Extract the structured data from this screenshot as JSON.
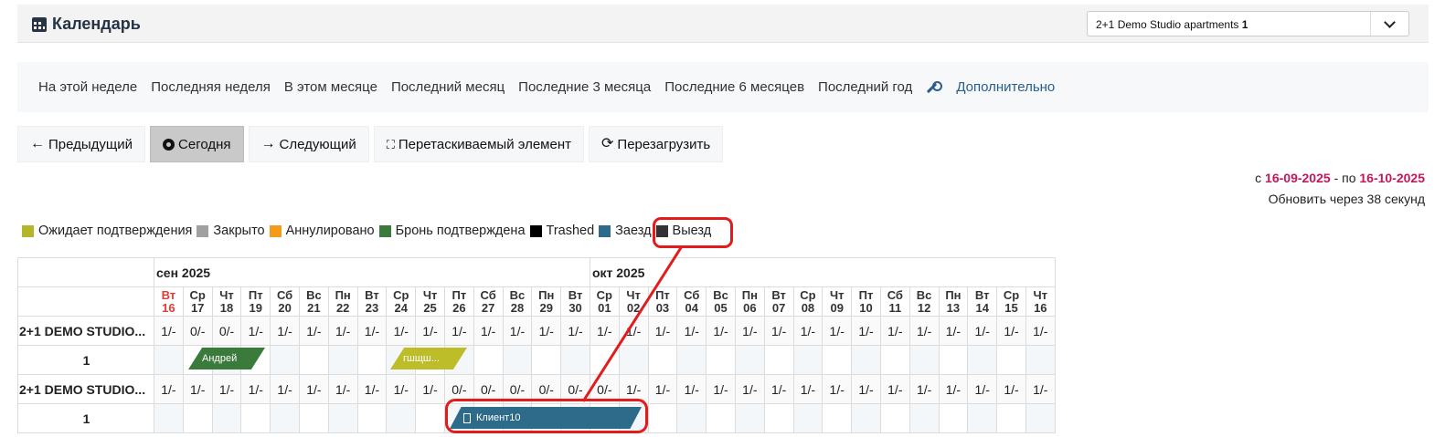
{
  "header": {
    "title": "Календарь",
    "property_select": {
      "name": "2+1 Demo Studio apartments",
      "number": "1"
    }
  },
  "ranges": [
    "На этой неделе",
    "Последняя неделя",
    "В этом месяце",
    "Последний месяц",
    "Последние 3 месяца",
    "Последние 6 месяцев",
    "Последний год"
  ],
  "ranges_more": "Дополнительно",
  "toolbar": {
    "prev": "Предыдущий",
    "today": "Сегодня",
    "next": "Следующий",
    "draggable": "Перетаскиваемый элемент",
    "reload": "Перезагрузить"
  },
  "date_range": {
    "from_label": "с",
    "from": "16-09-2025",
    "to_label": "- по",
    "to": "16-10-2025"
  },
  "refresh_text": "Обновить через 38 секунд",
  "legend": [
    {
      "label": "Ожидает подтверждения",
      "color": "#b5b52a"
    },
    {
      "label": "Закрыто",
      "color": "#a0a0a0"
    },
    {
      "label": "Аннулировано",
      "color": "#f59b1c"
    },
    {
      "label": "Бронь подтверждена",
      "color": "#3a7a3a"
    },
    {
      "label": "Trashed",
      "color": "#000000"
    },
    {
      "label": "Заезд",
      "color": "#2e6b8a"
    },
    {
      "label": "Выезд",
      "color": "#333333"
    }
  ],
  "calendar": {
    "months": [
      {
        "label": "сен 2025",
        "span": 15
      },
      {
        "label": "окт 2025",
        "span": 16
      }
    ],
    "days": [
      {
        "dow": "Вт",
        "num": "16",
        "today": true
      },
      {
        "dow": "Ср",
        "num": "17"
      },
      {
        "dow": "Чт",
        "num": "18"
      },
      {
        "dow": "Пт",
        "num": "19"
      },
      {
        "dow": "Сб",
        "num": "20"
      },
      {
        "dow": "Вс",
        "num": "21"
      },
      {
        "dow": "Пн",
        "num": "22"
      },
      {
        "dow": "Вт",
        "num": "23"
      },
      {
        "dow": "Ср",
        "num": "24"
      },
      {
        "dow": "Чт",
        "num": "25"
      },
      {
        "dow": "Пт",
        "num": "26"
      },
      {
        "dow": "Сб",
        "num": "27"
      },
      {
        "dow": "Вс",
        "num": "28"
      },
      {
        "dow": "Пн",
        "num": "29"
      },
      {
        "dow": "Вт",
        "num": "30"
      },
      {
        "dow": "Ср",
        "num": "01"
      },
      {
        "dow": "Чт",
        "num": "02"
      },
      {
        "dow": "Пт",
        "num": "03"
      },
      {
        "dow": "Сб",
        "num": "04"
      },
      {
        "dow": "Вс",
        "num": "05"
      },
      {
        "dow": "Пн",
        "num": "06"
      },
      {
        "dow": "Вт",
        "num": "07"
      },
      {
        "dow": "Ср",
        "num": "08"
      },
      {
        "dow": "Чт",
        "num": "09"
      },
      {
        "dow": "Пт",
        "num": "10"
      },
      {
        "dow": "Сб",
        "num": "11"
      },
      {
        "dow": "Вс",
        "num": "12"
      },
      {
        "dow": "Пн",
        "num": "13"
      },
      {
        "dow": "Вт",
        "num": "14"
      },
      {
        "dow": "Ср",
        "num": "15"
      },
      {
        "dow": "Чт",
        "num": "16"
      }
    ],
    "rows": [
      {
        "type": "avail",
        "label": "2+1 DEMO STUDIO...",
        "cells": [
          "1/-",
          "0/-",
          "0/-",
          "1/-",
          "1/-",
          "1/-",
          "1/-",
          "1/-",
          "1/-",
          "1/-",
          "1/-",
          "1/-",
          "1/-",
          "1/-",
          "1/-",
          "1/-",
          "1/-",
          "1/-",
          "1/-",
          "1/-",
          "1/-",
          "1/-",
          "1/-",
          "1/-",
          "1/-",
          "1/-",
          "1/-",
          "1/-",
          "1/-",
          "1/-",
          "1/-"
        ]
      },
      {
        "type": "bookings",
        "label": "1"
      },
      {
        "type": "avail",
        "label": "2+1 DEMO STUDIO...",
        "cells": [
          "1/-",
          "1/-",
          "1/-",
          "1/-",
          "1/-",
          "1/-",
          "1/-",
          "1/-",
          "1/-",
          "1/-",
          "0/-",
          "0/-",
          "0/-",
          "0/-",
          "0/-",
          "0/-",
          "1/-",
          "1/-",
          "1/-",
          "1/-",
          "1/-",
          "1/-",
          "1/-",
          "1/-",
          "1/-",
          "1/-",
          "1/-",
          "1/-",
          "1/-",
          "1/-",
          "1/-"
        ]
      },
      {
        "type": "bookings",
        "label": "1"
      }
    ],
    "bookings": [
      {
        "guest": "Андрей",
        "status_color": "#3a7a3a"
      },
      {
        "guest": "гшщш...",
        "status_color": "#bdbd2a"
      },
      {
        "guest": "Клиент10",
        "status_color": "#2e6b8a"
      }
    ]
  },
  "annotation_color": "#e31b1b"
}
